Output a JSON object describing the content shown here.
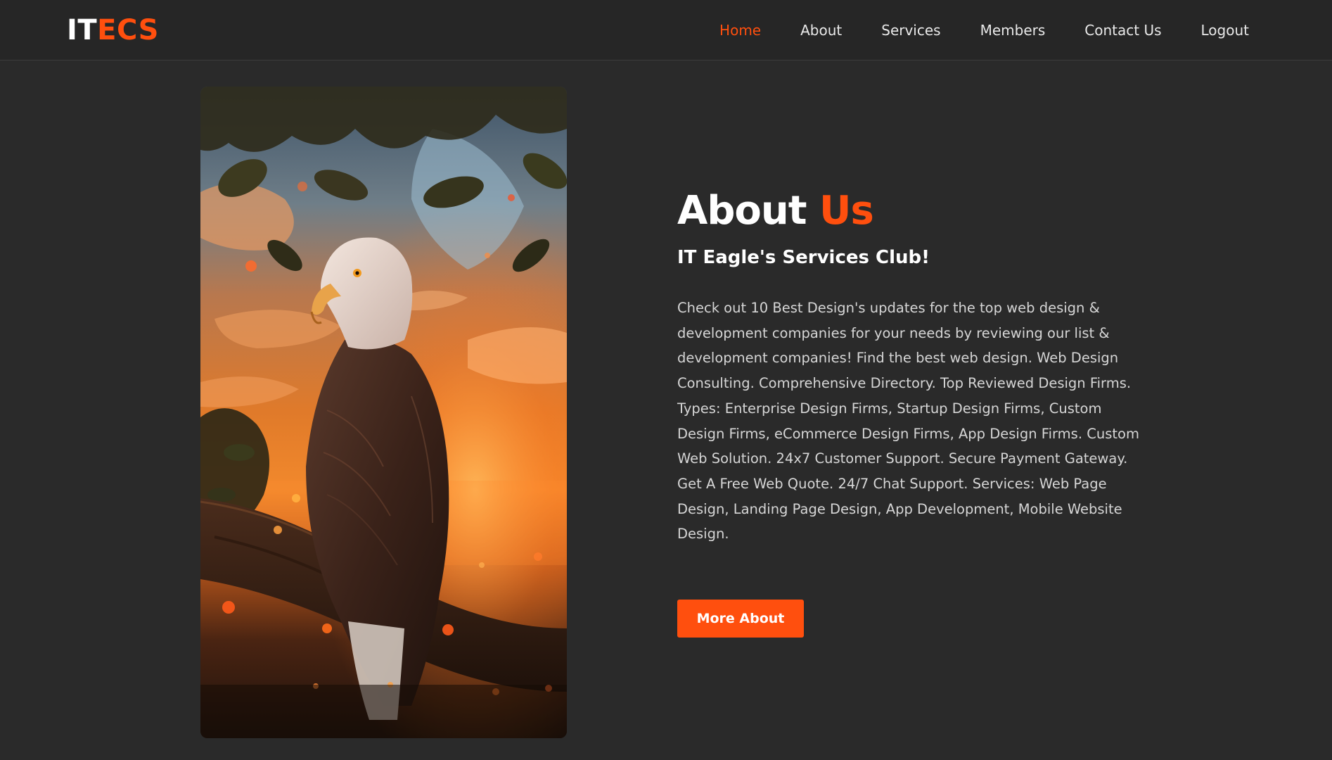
{
  "header": {
    "logo_part1": "IT",
    "logo_part2": "ECS",
    "nav": [
      {
        "label": "Home",
        "active": true
      },
      {
        "label": "About"
      },
      {
        "label": "Services"
      },
      {
        "label": "Members"
      },
      {
        "label": "Contact Us"
      },
      {
        "label": "Logout"
      }
    ]
  },
  "hero_image": {
    "subject": "bald eagle perched on branch at sunset",
    "icon": "eagle-photo"
  },
  "about": {
    "title_part1": "About ",
    "title_part2": "Us",
    "subtitle": "IT Eagle's Services Club!",
    "description": "Check out 10 Best Design's updates for the top web design & development companies for your needs by reviewing our list & development companies! Find the best web design. Web Design Consulting. Comprehensive Directory. Top Reviewed Design Firms. Types: Enterprise Design Firms, Startup Design Firms, Custom Design Firms, eCommerce Design Firms, App Design Firms. Custom Web Solution. 24x7 Customer Support. Secure Payment Gateway. Get A Free Web Quote. 24/7 Chat Support. Services: Web Page Design, Landing Page Design, App Development, Mobile Website Design.",
    "button_label": "More About"
  },
  "colors": {
    "accent": "#ff4f0e",
    "background": "#2a2a2a",
    "header_bg": "#262626",
    "text": "#ffffff",
    "muted_text": "#d6d6d6"
  }
}
